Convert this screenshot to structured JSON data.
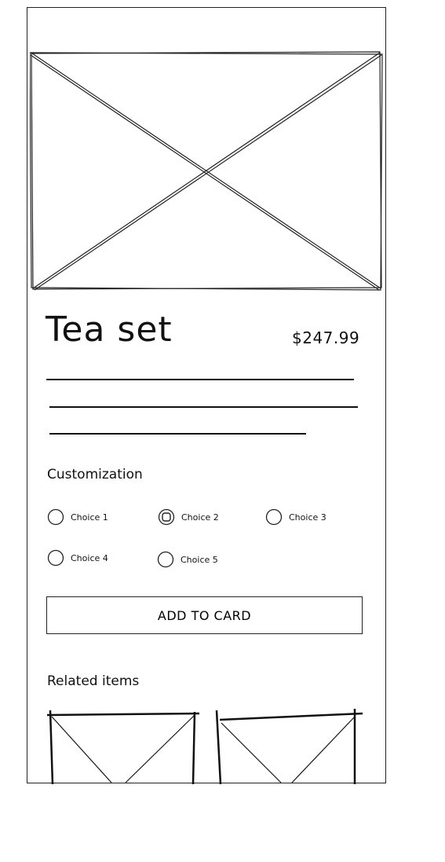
{
  "product": {
    "title": "Tea set",
    "price": "$247.99",
    "image_icon": "image-placeholder-icon"
  },
  "customization": {
    "label": "Customization",
    "choices": [
      {
        "label": "Choice 1",
        "selected": false
      },
      {
        "label": "Choice 2",
        "selected": true
      },
      {
        "label": "Choice 3",
        "selected": false
      },
      {
        "label": "Choice 4",
        "selected": false
      },
      {
        "label": "Choice 5",
        "selected": false
      }
    ]
  },
  "actions": {
    "add_label": "ADD TO CARD"
  },
  "related": {
    "label": "Related items"
  }
}
